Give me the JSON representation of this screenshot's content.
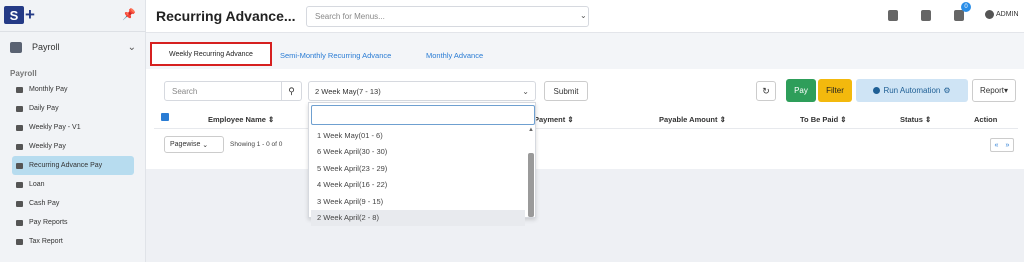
{
  "app": {
    "title": "Recurring Advance...",
    "search_placeholder": "Search for Menus...",
    "user": "ADMIN",
    "notification_count": "0"
  },
  "sidebar": {
    "module": "Payroll",
    "section": "Payroll",
    "items": [
      {
        "label": "Monthly Pay"
      },
      {
        "label": "Daily Pay"
      },
      {
        "label": "Weekly Pay - V1"
      },
      {
        "label": "Weekly Pay"
      },
      {
        "label": "Recurring Advance Pay"
      },
      {
        "label": "Loan"
      },
      {
        "label": "Cash Pay"
      },
      {
        "label": "Pay Reports"
      },
      {
        "label": "Tax Report"
      }
    ]
  },
  "tabs": [
    "Weekly Recurring Advance",
    "Semi-Monthly Recurring Advance",
    "Monthly Advance"
  ],
  "toolbar": {
    "search_placeholder": "Search",
    "period_selected": "2 Week May(7 - 13)",
    "submit": "Submit",
    "pay": "Pay",
    "filter": "Filter",
    "run_automation": "Run Automation",
    "report": "Report"
  },
  "table": {
    "headers": [
      "Employee Name",
      "Payment",
      "Payable Amount",
      "To Be Paid",
      "Status",
      "Action"
    ],
    "paging": "Pagewise",
    "showing": "Showing 1 - 0 of 0"
  },
  "dropdown": {
    "options": [
      "1 Week May(01 - 6)",
      "6 Week April(30 - 30)",
      "5 Week April(23 - 29)",
      "4 Week April(16 - 22)",
      "3 Week April(9 - 15)",
      "2 Week April(2 - 8)"
    ],
    "highlighted_index": 5
  },
  "colors": {
    "accent": "#2a7cd4",
    "pay": "#2e9e5a",
    "filter": "#f3b90d",
    "active_item": "#b7dcef",
    "tab_outline": "#d62020"
  }
}
